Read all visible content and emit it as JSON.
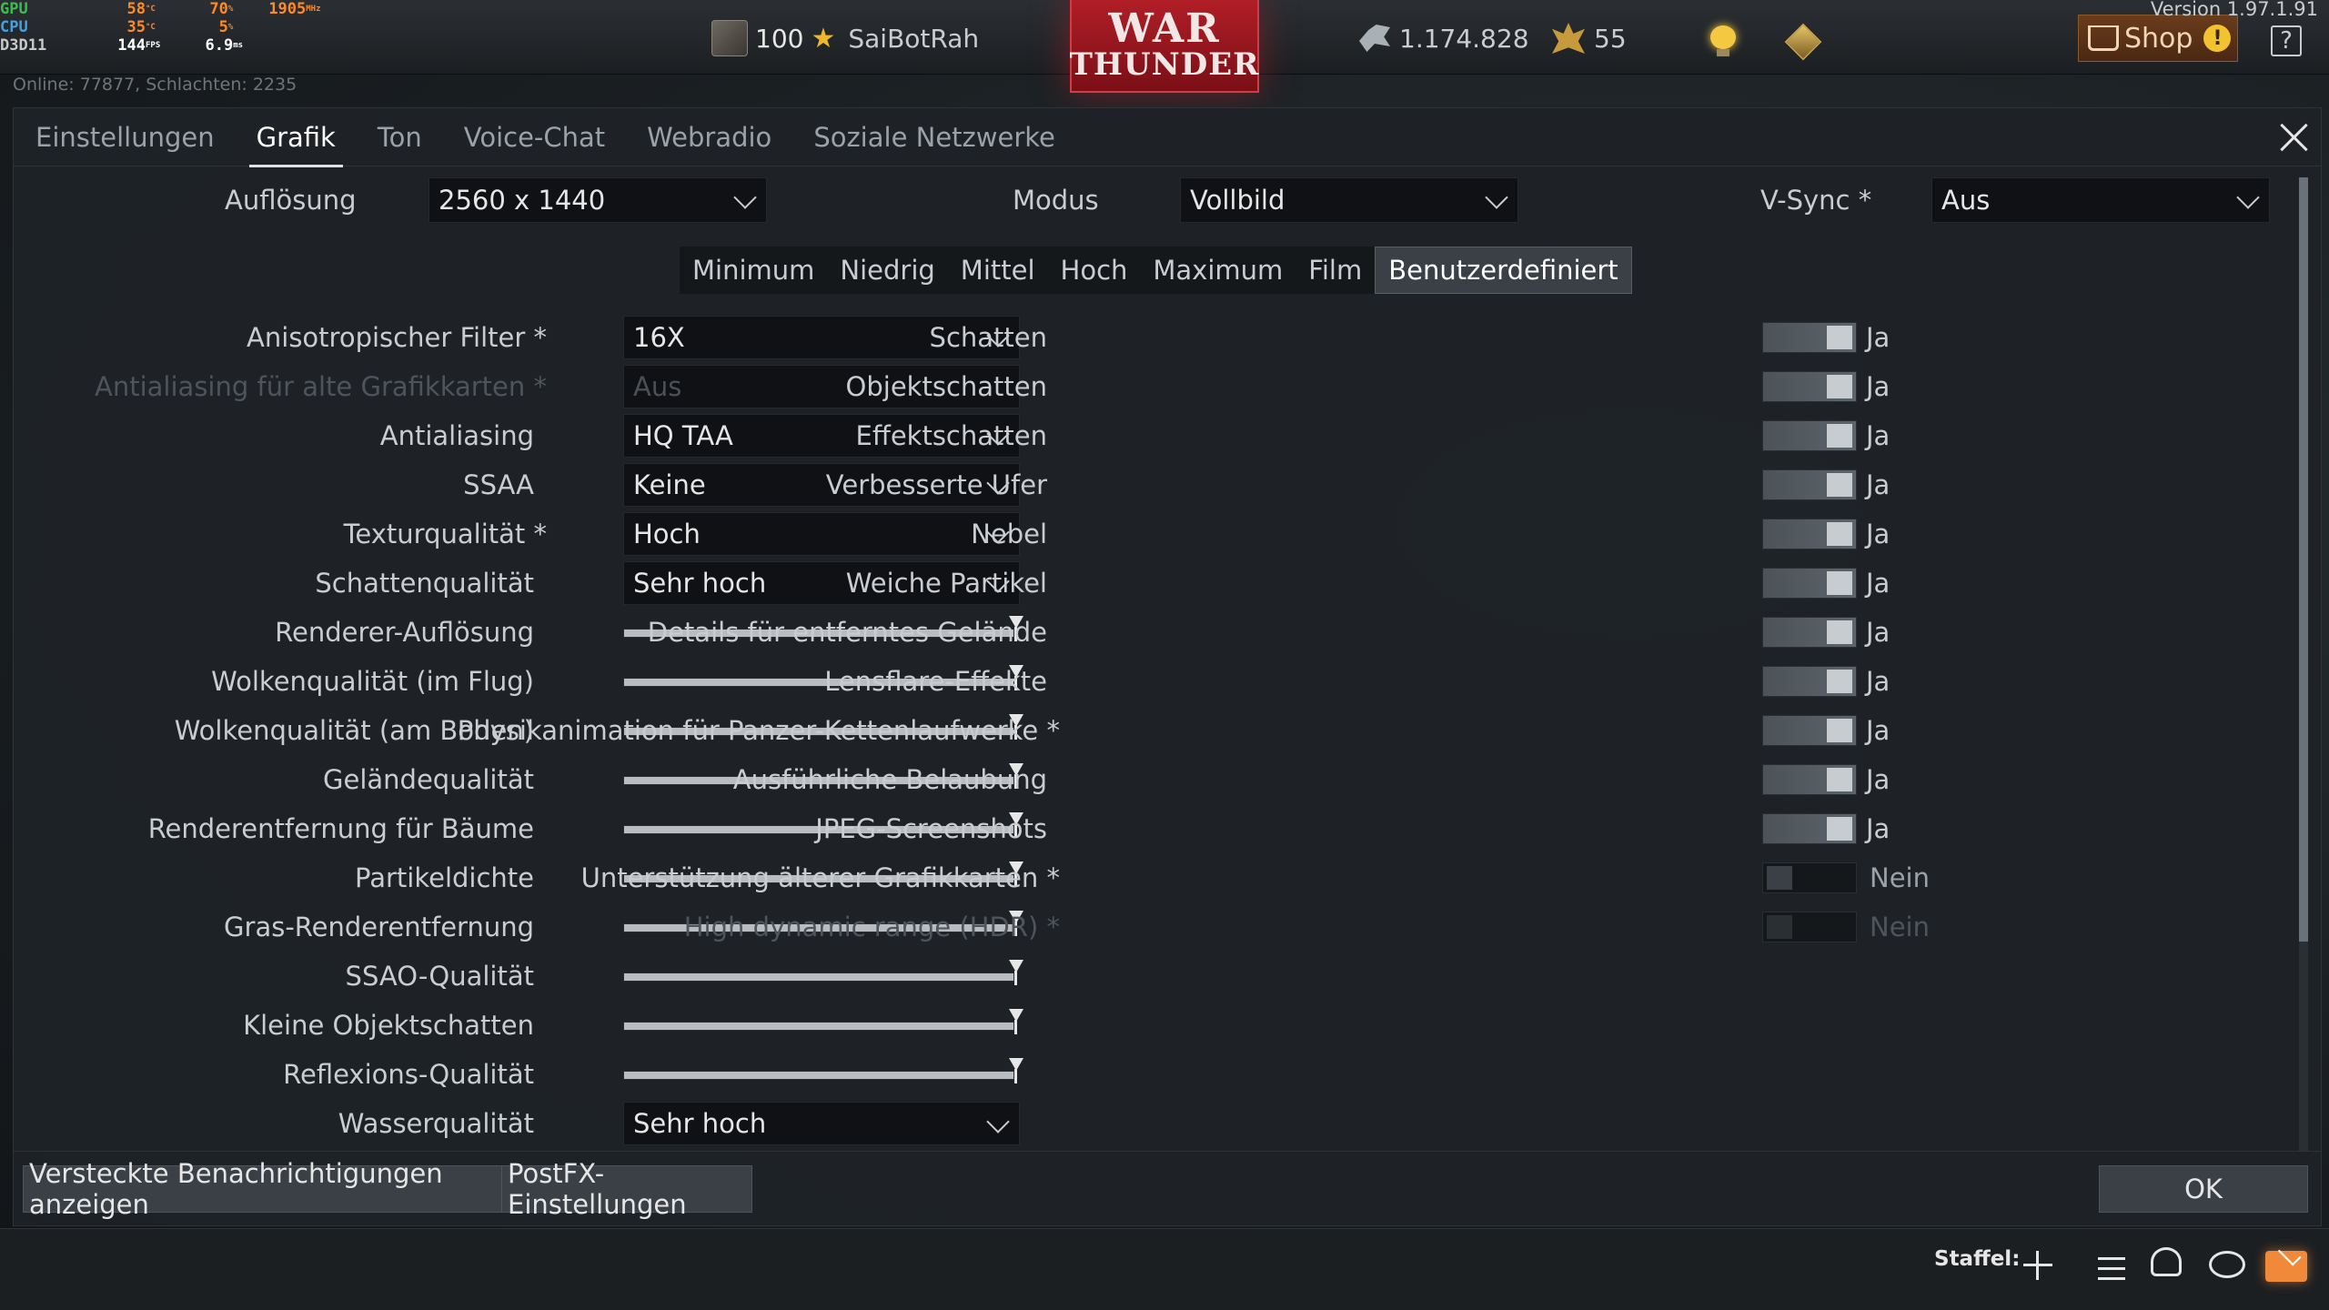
{
  "perf": {
    "rows": [
      {
        "label": "GPU",
        "v1": "58",
        "u1": "°C",
        "v2": "70",
        "u2": "%",
        "v3": "1905",
        "u3": "MHz"
      },
      {
        "label": "CPU",
        "v1": "35",
        "u1": "°C",
        "v2": "5",
        "u2": "%",
        "v3": "",
        "u3": ""
      },
      {
        "label": "D3D11",
        "v1": "144",
        "u1": "FPS",
        "v2": "6.9",
        "u2": "ms",
        "v3": "",
        "u3": ""
      }
    ]
  },
  "online_text": "Online: 77877, Schlachten: 2235",
  "player": {
    "level": "100",
    "name": "SaiBotRah"
  },
  "logo": {
    "line1": "WAR",
    "line2": "THUNDER"
  },
  "silver_lions": "1.174.828",
  "golden_eagles": "55",
  "shop_label": "Shop",
  "version": "Version 1.97.1.91",
  "tabs": [
    {
      "label": "Einstellungen",
      "active": false
    },
    {
      "label": "Grafik",
      "active": true
    },
    {
      "label": "Ton",
      "active": false
    },
    {
      "label": "Voice-Chat",
      "active": false
    },
    {
      "label": "Webradio",
      "active": false
    },
    {
      "label": "Soziale Netzwerke",
      "active": false
    }
  ],
  "resolution": {
    "label": "Auflösung",
    "value": "2560 x 1440"
  },
  "mode": {
    "label": "Modus",
    "value": "Vollbild"
  },
  "vsync": {
    "label": "V-Sync *",
    "value": "Aus"
  },
  "presets": [
    "Minimum",
    "Niedrig",
    "Mittel",
    "Hoch",
    "Maximum",
    "Film",
    "Benutzerdefiniert"
  ],
  "active_preset": "Benutzerdefiniert",
  "left_options": [
    {
      "label": "Anisotropischer Filter *",
      "type": "select",
      "value": "16X"
    },
    {
      "label": "Antialiasing für alte Grafikkarten *",
      "type": "select-disabled",
      "value": "Aus"
    },
    {
      "label": "Antialiasing",
      "type": "select",
      "value": "HQ TAA"
    },
    {
      "label": "SSAA",
      "type": "select",
      "value": "Keine"
    },
    {
      "label": "Texturqualität *",
      "type": "select",
      "value": "Hoch"
    },
    {
      "label": "Schattenqualität",
      "type": "select",
      "value": "Sehr hoch"
    },
    {
      "label": "Renderer-Auflösung",
      "type": "slider",
      "level": 1.0
    },
    {
      "label": "Wolkenqualität (im Flug)",
      "type": "slider",
      "level": 1.0
    },
    {
      "label": "Wolkenqualität (am Boden)",
      "type": "slider",
      "level": 1.0
    },
    {
      "label": "Geländequalität",
      "type": "slider",
      "level": 1.0
    },
    {
      "label": "Renderentfernung für Bäume",
      "type": "slider",
      "level": 1.0
    },
    {
      "label": "Partikeldichte",
      "type": "slider",
      "level": 1.0
    },
    {
      "label": "Gras-Renderentfernung",
      "type": "slider",
      "level": 1.0
    },
    {
      "label": "SSAO-Qualität",
      "type": "slider",
      "level": 1.0
    },
    {
      "label": "Kleine Objektschatten",
      "type": "slider",
      "level": 1.0
    },
    {
      "label": "Reflexions-Qualität",
      "type": "slider",
      "level": 1.0
    },
    {
      "label": "Wasserqualität",
      "type": "select",
      "value": "Sehr hoch"
    }
  ],
  "right_options": [
    {
      "label": "Schatten",
      "on": true,
      "text": "Ja"
    },
    {
      "label": "Objektschatten",
      "on": true,
      "text": "Ja"
    },
    {
      "label": "Effektschatten",
      "on": true,
      "text": "Ja"
    },
    {
      "label": "Verbesserte Ufer",
      "on": true,
      "text": "Ja"
    },
    {
      "label": "Nebel",
      "on": true,
      "text": "Ja"
    },
    {
      "label": "Weiche Partikel",
      "on": true,
      "text": "Ja"
    },
    {
      "label": "Details für entferntes Gelände",
      "on": true,
      "text": "Ja"
    },
    {
      "label": "Lensflare-Effekte",
      "on": true,
      "text": "Ja"
    },
    {
      "label": "Physikanimation für Panzer-Kettenlaufwerke *",
      "on": true,
      "text": "Ja"
    },
    {
      "label": "Ausführliche Belaubung",
      "on": true,
      "text": "Ja"
    },
    {
      "label": "JPEG-Screenshots",
      "on": true,
      "text": "Ja"
    },
    {
      "label": "Unterstützung älterer Grafikkarten *",
      "on": false,
      "text": "Nein"
    },
    {
      "label": "High dynamic range (HDR) *",
      "on": false,
      "text": "Nein",
      "disabled": true
    }
  ],
  "footer": {
    "hidden_notifications": "Versteckte Benachrichtigungen anzeigen",
    "postfx": "PostFX-Einstellungen",
    "ok": "OK"
  },
  "bottom": {
    "squad_label": "Staffel:"
  }
}
